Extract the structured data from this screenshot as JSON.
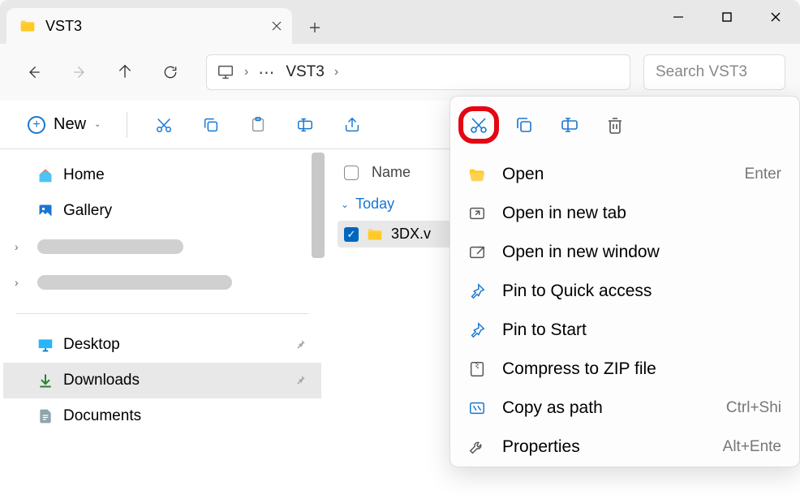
{
  "window": {
    "title": "VST3"
  },
  "tab": {
    "title": "VST3"
  },
  "breadcrumb": {
    "current": "VST3"
  },
  "search": {
    "placeholder": "Search VST3"
  },
  "toolbar": {
    "new_label": "New"
  },
  "sidebar": {
    "home": "Home",
    "gallery": "Gallery",
    "desktop": "Desktop",
    "downloads": "Downloads",
    "documents": "Documents"
  },
  "list": {
    "header_name": "Name",
    "group_today": "Today",
    "file1": "3DX.v"
  },
  "ctx": {
    "open": "Open",
    "open_shortcut": "Enter",
    "open_tab": "Open in new tab",
    "open_window": "Open in new window",
    "pin_quick": "Pin to Quick access",
    "pin_start": "Pin to Start",
    "compress": "Compress to ZIP file",
    "copy_path": "Copy as path",
    "copy_path_shortcut": "Ctrl+Shi",
    "properties": "Properties",
    "properties_shortcut": "Alt+Ente"
  }
}
